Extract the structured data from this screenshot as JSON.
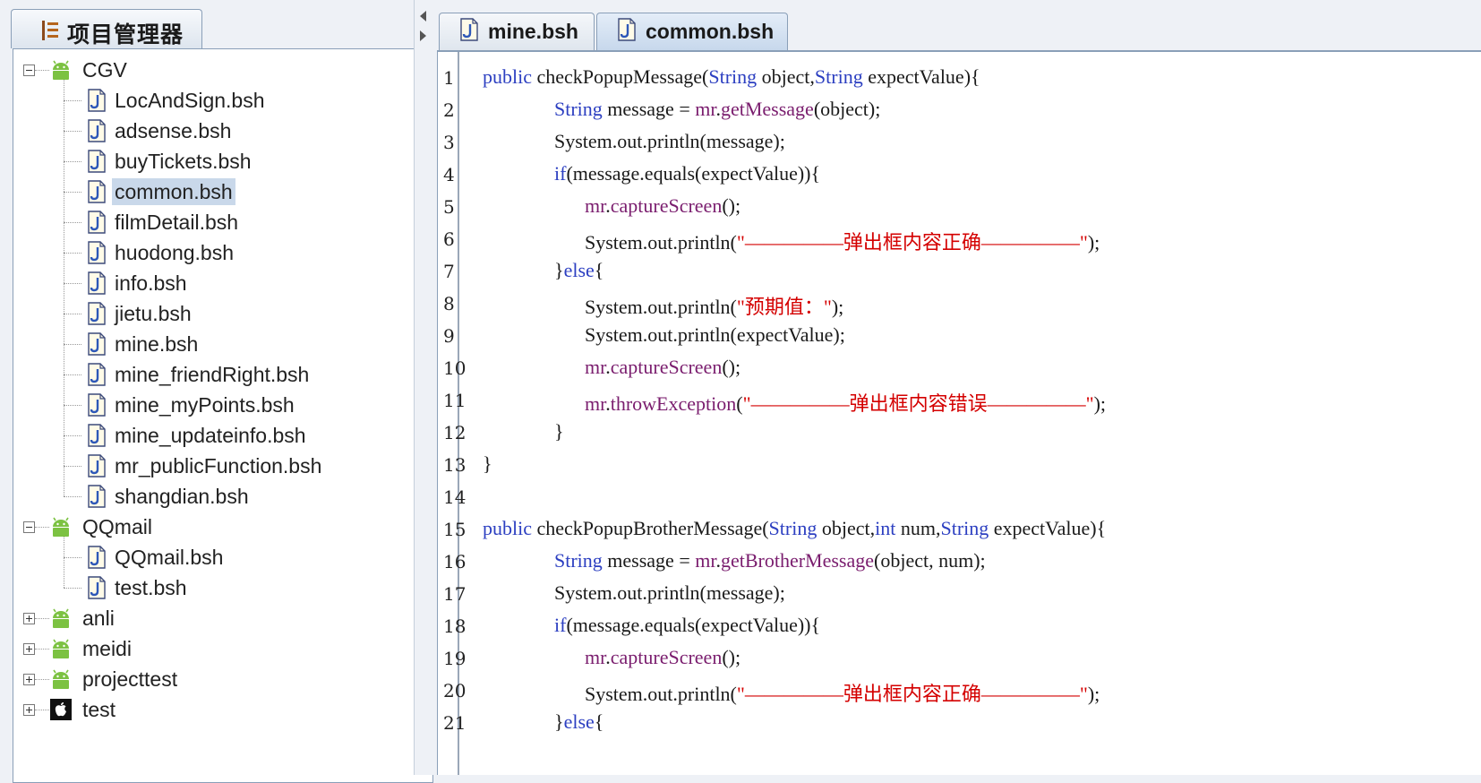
{
  "project_panel": {
    "title": "项目管理器",
    "tree": [
      {
        "label": "CGV",
        "type": "android",
        "expanded": true,
        "children": [
          "LocAndSign.bsh",
          "adsense.bsh",
          "buyTickets.bsh",
          "common.bsh",
          "filmDetail.bsh",
          "huodong.bsh",
          "info.bsh",
          "jietu.bsh",
          "mine.bsh",
          "mine_friendRight.bsh",
          "mine_myPoints.bsh",
          "mine_updateinfo.bsh",
          "mr_publicFunction.bsh",
          "shangdian.bsh"
        ]
      },
      {
        "label": "QQmail",
        "type": "android",
        "expanded": true,
        "children": [
          "QQmail.bsh",
          "test.bsh"
        ]
      },
      {
        "label": "anli",
        "type": "android",
        "expanded": false
      },
      {
        "label": "meidi",
        "type": "android",
        "expanded": false
      },
      {
        "label": "projecttest",
        "type": "android",
        "expanded": false
      },
      {
        "label": "test",
        "type": "apple",
        "expanded": false
      }
    ],
    "selected_file": "common.bsh"
  },
  "editor": {
    "tabs": [
      {
        "label": "mine.bsh",
        "active": false
      },
      {
        "label": "common.bsh",
        "active": true
      }
    ],
    "lines": [
      {
        "n": "1",
        "indent": 0,
        "tokens": [
          [
            "kw",
            "public"
          ],
          [
            "t",
            " checkPopupMessage("
          ],
          [
            "kw",
            "String"
          ],
          [
            "t",
            " object,"
          ],
          [
            "kw",
            "String"
          ],
          [
            "t",
            " expectValue){"
          ]
        ]
      },
      {
        "n": "2",
        "indent": 1,
        "tokens": [
          [
            "kw",
            "String"
          ],
          [
            "t",
            " message = "
          ],
          [
            "fn",
            "mr"
          ],
          [
            "t",
            "."
          ],
          [
            "fn",
            "getMessage"
          ],
          [
            "t",
            "(object);"
          ]
        ]
      },
      {
        "n": "3",
        "indent": 1,
        "tokens": [
          [
            "t",
            "System.out.println(message);"
          ]
        ]
      },
      {
        "n": "4",
        "indent": 1,
        "tokens": [
          [
            "kw",
            "if"
          ],
          [
            "t",
            "(message.equals(expectValue)){"
          ]
        ]
      },
      {
        "n": "5",
        "indent": 2,
        "tokens": [
          [
            "fn",
            "mr"
          ],
          [
            "t",
            "."
          ],
          [
            "fn",
            "captureScreen"
          ],
          [
            "t",
            "();"
          ]
        ]
      },
      {
        "n": "6",
        "indent": 2,
        "tokens": [
          [
            "t",
            "System.out.println("
          ],
          [
            "str",
            "\"—————弹出框内容正确—————\""
          ],
          [
            "t",
            ");"
          ]
        ]
      },
      {
        "n": "7",
        "indent": 1,
        "tokens": [
          [
            "t",
            "}"
          ],
          [
            "kw",
            "else"
          ],
          [
            "t",
            "{"
          ]
        ]
      },
      {
        "n": "8",
        "indent": 2,
        "tokens": [
          [
            "t",
            "System.out.println("
          ],
          [
            "str",
            "\"预期值：\""
          ],
          [
            "t",
            ");"
          ]
        ]
      },
      {
        "n": "9",
        "indent": 2,
        "tokens": [
          [
            "t",
            "System.out.println(expectValue);"
          ]
        ]
      },
      {
        "n": "10",
        "indent": 2,
        "tokens": [
          [
            "fn",
            "mr"
          ],
          [
            "t",
            "."
          ],
          [
            "fn",
            "captureScreen"
          ],
          [
            "t",
            "();"
          ]
        ]
      },
      {
        "n": "11",
        "indent": 2,
        "tokens": [
          [
            "fn",
            "mr"
          ],
          [
            "t",
            "."
          ],
          [
            "fn",
            "throwException"
          ],
          [
            "t",
            "("
          ],
          [
            "str",
            "\"—————弹出框内容错误—————\""
          ],
          [
            "t",
            ");"
          ]
        ]
      },
      {
        "n": "12",
        "indent": 1,
        "tokens": [
          [
            "t",
            "}"
          ]
        ]
      },
      {
        "n": "13",
        "indent": 0,
        "tokens": [
          [
            "t",
            "}"
          ]
        ]
      },
      {
        "n": "14",
        "indent": 0,
        "tokens": []
      },
      {
        "n": "15",
        "indent": 0,
        "tokens": [
          [
            "kw",
            "public"
          ],
          [
            "t",
            " checkPopupBrotherMessage("
          ],
          [
            "kw",
            "String"
          ],
          [
            "t",
            " object,"
          ],
          [
            "kw",
            "int"
          ],
          [
            "t",
            " num,"
          ],
          [
            "kw",
            "String"
          ],
          [
            "t",
            " expectValue){"
          ]
        ]
      },
      {
        "n": "16",
        "indent": 1,
        "tokens": [
          [
            "kw",
            "String"
          ],
          [
            "t",
            " message = "
          ],
          [
            "fn",
            "mr"
          ],
          [
            "t",
            "."
          ],
          [
            "fn",
            "getBrotherMessage"
          ],
          [
            "t",
            "(object, num);"
          ]
        ]
      },
      {
        "n": "17",
        "indent": 1,
        "tokens": [
          [
            "t",
            "System.out.println(message);"
          ]
        ]
      },
      {
        "n": "18",
        "indent": 1,
        "tokens": [
          [
            "kw",
            "if"
          ],
          [
            "t",
            "(message.equals(expectValue)){"
          ]
        ]
      },
      {
        "n": "19",
        "indent": 2,
        "tokens": [
          [
            "fn",
            "mr"
          ],
          [
            "t",
            "."
          ],
          [
            "fn",
            "captureScreen"
          ],
          [
            "t",
            "();"
          ]
        ]
      },
      {
        "n": "20",
        "indent": 2,
        "tokens": [
          [
            "t",
            "System.out.println("
          ],
          [
            "str",
            "\"—————弹出框内容正确—————\""
          ],
          [
            "t",
            ");"
          ]
        ]
      },
      {
        "n": "21",
        "indent": 1,
        "tokens": [
          [
            "t",
            "}"
          ],
          [
            "kw",
            "else"
          ],
          [
            "t",
            "{"
          ]
        ]
      }
    ]
  },
  "colors": {
    "keyword": "#2c3fc1",
    "function": "#7a1d6e",
    "string": "#d40000",
    "selection": "#c9d8ea"
  }
}
